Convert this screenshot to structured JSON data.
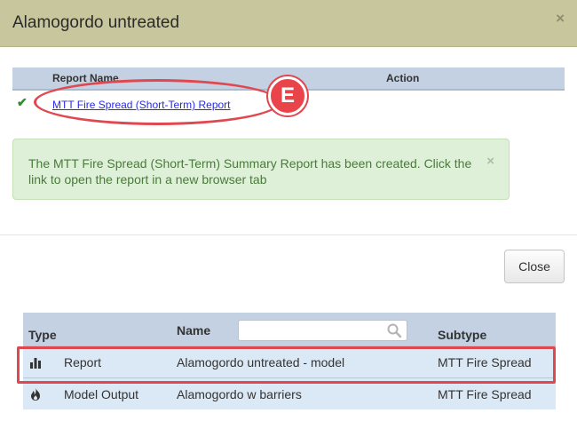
{
  "dialog": {
    "title": "Alamogordo untreated",
    "close_icon": "×"
  },
  "report_table": {
    "headers": {
      "name": "Report Name",
      "action": "Action"
    },
    "rows": [
      {
        "status_icon": "✔",
        "link_text": "MTT Fire Spread (Short-Term) Report"
      }
    ]
  },
  "callout": {
    "label": "E",
    "color": "#e0484f"
  },
  "alert": {
    "text": "The MTT Fire Spread (Short-Term) Summary Report has been created. Click the link to open the report in a new browser tab",
    "close_icon": "×"
  },
  "buttons": {
    "close_label": "Close"
  },
  "item_table": {
    "headers": {
      "type": "Type",
      "name": "Name",
      "subtype": "Subtype"
    },
    "search": {
      "value": "",
      "placeholder": ""
    },
    "rows": [
      {
        "icon": "bar-chart-icon",
        "type": "Report",
        "name": "Alamogordo untreated - model",
        "subtype": "MTT Fire Spread"
      },
      {
        "icon": "fire-icon",
        "type": "Model Output",
        "name": "Alamogordo w barriers",
        "subtype": "MTT Fire Spread"
      }
    ]
  },
  "colors": {
    "header_bg": "#c8c69c",
    "table_header_bg": "#c3d1e3",
    "row_bg": "#dbe8f5",
    "alert_bg": "#dff0d8",
    "highlight": "#e0484f"
  }
}
